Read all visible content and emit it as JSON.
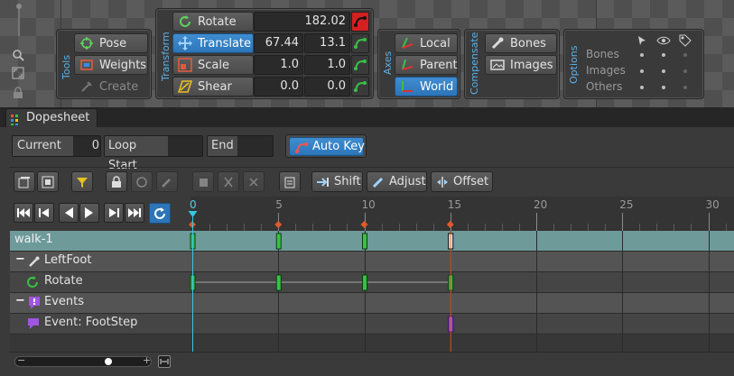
{
  "tools": {
    "label": "Tools",
    "pose": "Pose",
    "weights": "Weights",
    "create": "Create"
  },
  "transform": {
    "label": "Transform",
    "rotate": {
      "label": "Rotate",
      "value": "182.02"
    },
    "translate": {
      "label": "Translate",
      "x": "67.44",
      "y": "13.1"
    },
    "scale": {
      "label": "Scale",
      "x": "1.0",
      "y": "1.0"
    },
    "shear": {
      "label": "Shear",
      "x": "0.0",
      "y": "0.0"
    }
  },
  "axes": {
    "label": "Axes",
    "local": "Local",
    "parent": "Parent",
    "world": "World"
  },
  "compensate": {
    "label": "Compensate",
    "bones": "Bones",
    "images": "Images"
  },
  "options": {
    "label": "Options",
    "rows": [
      "Bones",
      "Images",
      "Others"
    ]
  },
  "dopesheet": {
    "tab": "Dopesheet",
    "current_label": "Current",
    "current_value": "0",
    "loop_start_label": "Loop Start",
    "end_label": "End",
    "auto_key": "Auto Key",
    "shift": "Shift",
    "adjust": "Adjust",
    "offset": "Offset",
    "ruler_labels": [
      "0",
      "5",
      "10",
      "15",
      "20",
      "25",
      "30"
    ],
    "rows": {
      "animation": "walk-1",
      "bone": "LeftFoot",
      "rotate": "Rotate",
      "events": "Events",
      "event": "Event: FootStep"
    },
    "rotate_keys": [
      0,
      5,
      10,
      15
    ],
    "event_keys": [
      15
    ],
    "current_frame": 0,
    "colors": {
      "accent": "#3f8dd0",
      "key": "#39c047",
      "event": "#a055e0",
      "playhead": "#35c8e0"
    }
  }
}
